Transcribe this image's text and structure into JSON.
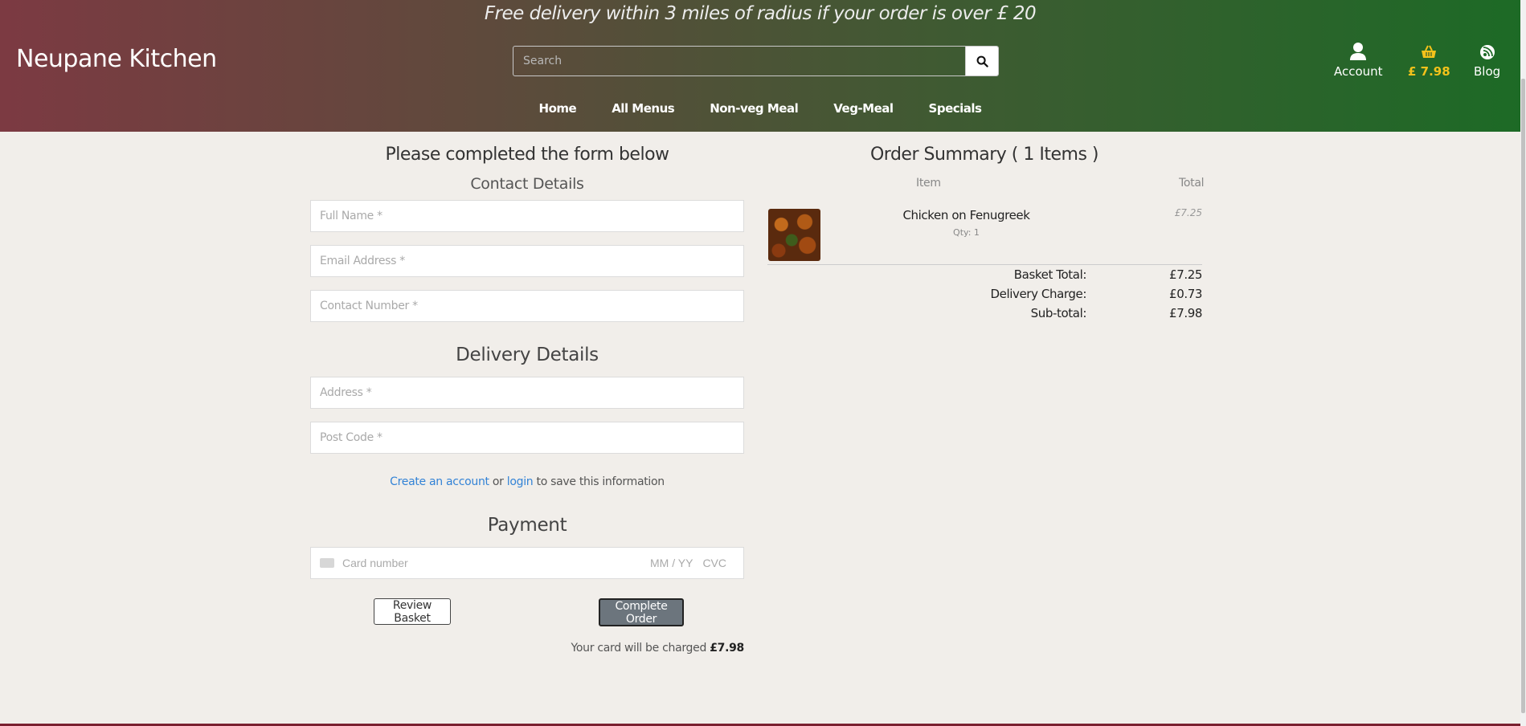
{
  "header": {
    "promo": "Free delivery within 3 miles of radius if your order is over £ 20",
    "brand": "Neupane Kitchen",
    "search_placeholder": "Search",
    "account_label": "Account",
    "basket_total": "£ 7.98",
    "blog_label": "Blog"
  },
  "nav": {
    "items": [
      "Home",
      "All Menus",
      "Non-veg Meal",
      "Veg-Meal",
      "Specials"
    ]
  },
  "form": {
    "title": "Please completed the form below",
    "contact_title": "Contact Details",
    "full_name_placeholder": "Full Name *",
    "email_placeholder": "Email Address *",
    "phone_placeholder": "Contact Number *",
    "delivery_title": "Delivery Details",
    "address_placeholder": "Address *",
    "postcode_placeholder": "Post Code *",
    "create_account_link": "Create an account",
    "or_text": "or",
    "login_link": "login",
    "save_text": "to save this information",
    "payment_title": "Payment",
    "card_number_placeholder": "Card number",
    "card_expiry_placeholder": "MM / YY",
    "card_cvc_placeholder": "CVC",
    "review_button": "Review Basket",
    "complete_button": "Complete Order",
    "charge_text": "Your card will be charged",
    "charge_amount": "£7.98"
  },
  "summary": {
    "title": "Order Summary ( 1 Items )",
    "col_item": "Item",
    "col_total": "Total",
    "items": [
      {
        "name": "Chicken on Fenugreek",
        "qty": "Qty: 1",
        "price": "£7.25"
      }
    ],
    "basket_total_label": "Basket Total:",
    "basket_total": "£7.25",
    "delivery_label": "Delivery Charge:",
    "delivery": "£0.73",
    "subtotal_label": "Sub-total:",
    "subtotal": "£7.98"
  },
  "colors": {
    "header_left": "#7c3a42",
    "header_right": "#1d6a26",
    "basket_accent": "#f3c21b",
    "link": "#3383d6",
    "complete_button": "#6c757d"
  }
}
